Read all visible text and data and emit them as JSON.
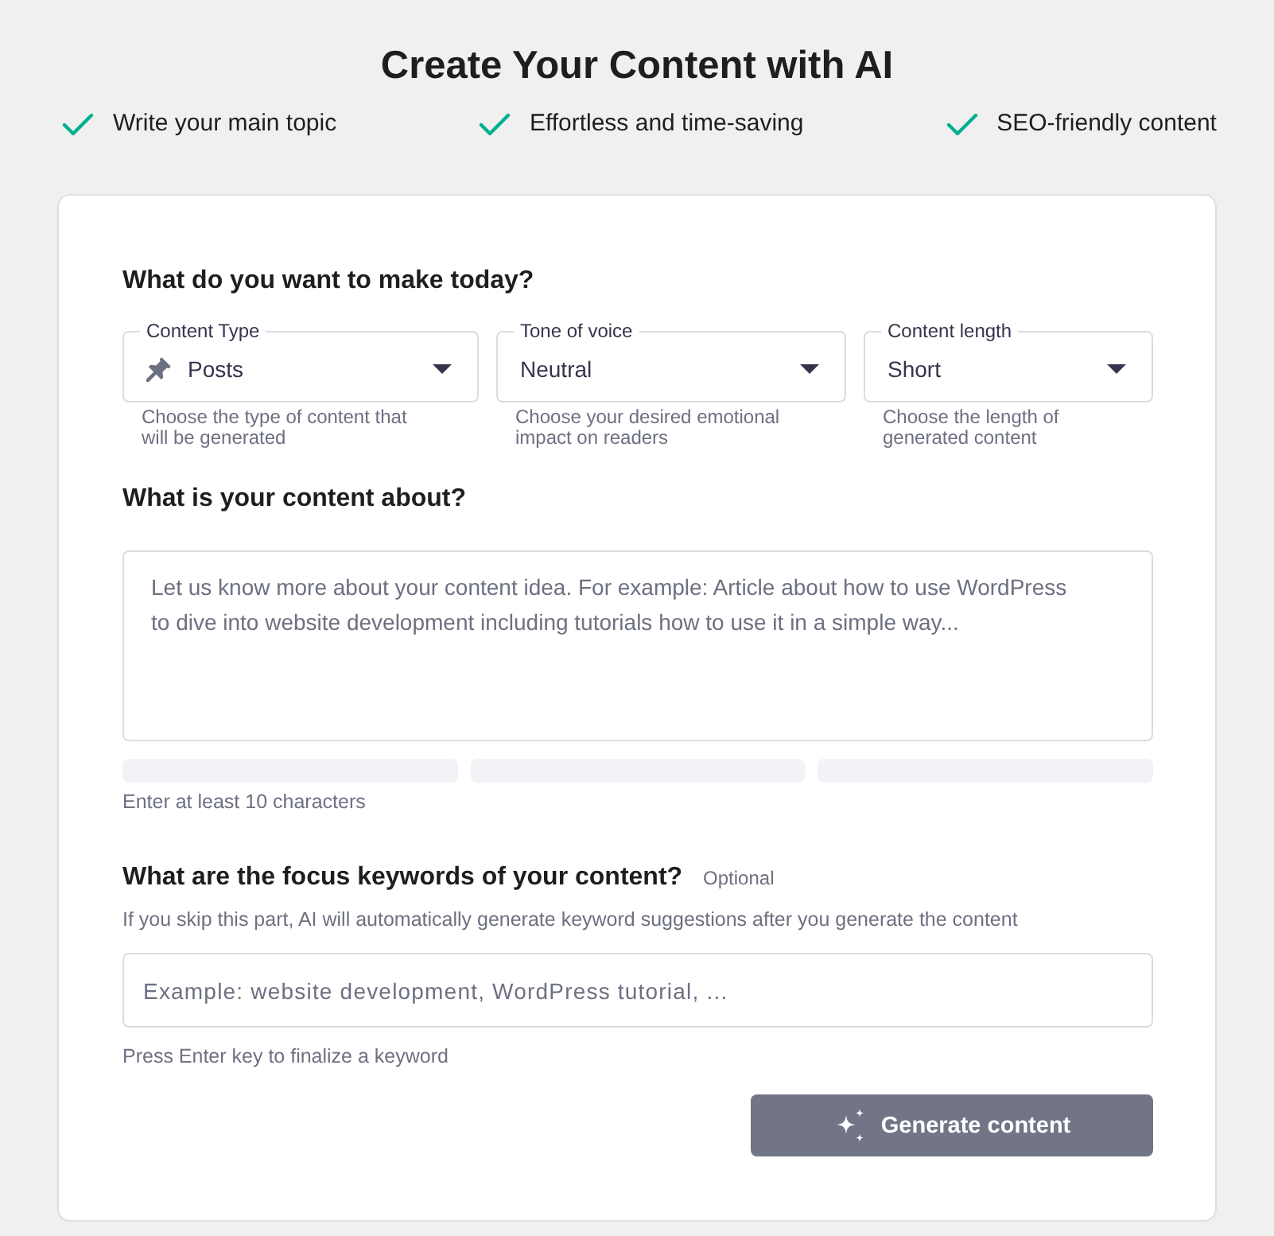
{
  "header": {
    "title": "Create Your Content with AI",
    "features": [
      "Write your main topic",
      "Effortless and time-saving",
      "SEO-friendly content"
    ]
  },
  "make_section": {
    "heading": "What do you want to make today?",
    "selects": [
      {
        "kind": "pinned",
        "label": "Content Type",
        "value": "Posts",
        "hint": "Choose the type of content that will be generated"
      },
      {
        "kind": "plain",
        "label": "Tone of voice",
        "value": "Neutral",
        "hint": "Choose your desired emotional impact on readers"
      },
      {
        "kind": "plain",
        "label": "Content length",
        "value": "Short",
        "hint": "Choose the length of generated content"
      }
    ]
  },
  "about_section": {
    "heading": "What is your content about?",
    "textarea": {
      "placeholder": "Let us know more about your content idea. For example: Article about how to use WordPress to dive into website development including tutorials how to use it in a simple way..."
    },
    "meter_segments": [
      {
        "filled": false
      },
      {
        "filled": false
      },
      {
        "filled": false
      }
    ],
    "hint": "Enter at least 10 characters"
  },
  "keywords_section": {
    "heading": "What are the focus keywords of your content?",
    "tag": "Optional",
    "description": "If you skip this part, AI will automatically generate keyword suggestions after you generate the content",
    "input": {
      "placeholder": "Example: website development, WordPress tutorial, ..."
    },
    "hint": "Press Enter key to finalize a keyword"
  },
  "generate_button": {
    "label": "Generate content",
    "disabled": true
  }
}
